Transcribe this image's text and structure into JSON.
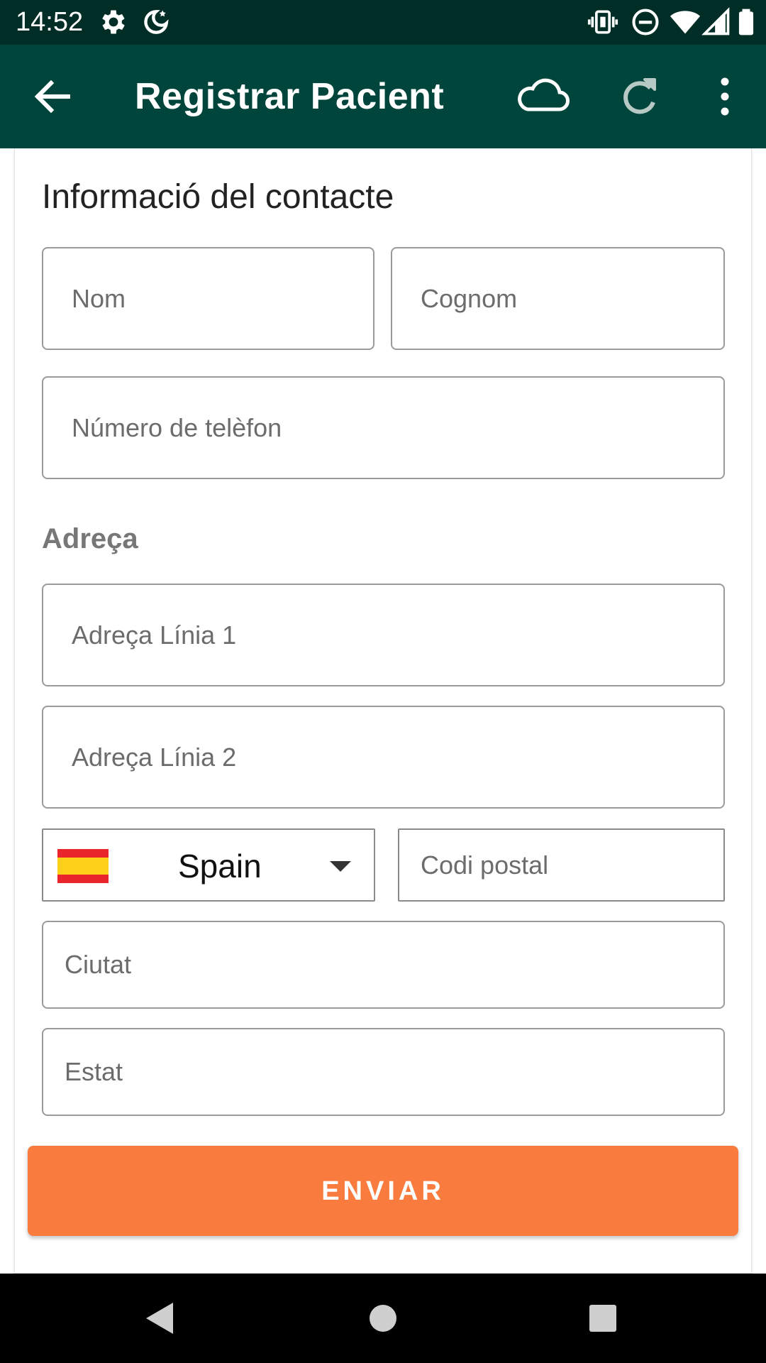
{
  "status_bar": {
    "time": "14:52",
    "left_icons": [
      "settings-icon",
      "night-mode-icon"
    ],
    "right_icons": [
      "vibrate-icon",
      "do-not-disturb-icon",
      "wifi-icon",
      "signal-icon",
      "battery-icon"
    ]
  },
  "app_bar": {
    "title": "Registrar Pacient",
    "back_icon": "arrow-left-icon",
    "actions": [
      "cloud-icon",
      "refresh-icon",
      "more-vert-icon"
    ]
  },
  "form": {
    "section_title": "Informació del contacte",
    "first_name_placeholder": "Nom",
    "last_name_placeholder": "Cognom",
    "phone_placeholder": "Número de telèfon",
    "address_title": "Adreça",
    "address1_placeholder": "Adreça Línia 1",
    "address2_placeholder": "Adreça Línia 2",
    "country": {
      "selected": "Spain",
      "flag": "spain-flag-icon"
    },
    "postal_placeholder": "Codi postal",
    "city_placeholder": "Ciutat",
    "state_placeholder": "Estat",
    "submit_label": "ENVIAR"
  },
  "colors": {
    "status_bar": "#002d26",
    "app_bar": "#00453b",
    "submit_button": "#f97b3e",
    "section_subtitle": "#777777"
  },
  "nav_bar": {
    "buttons": [
      "back-triangle-icon",
      "home-circle-icon",
      "recents-square-icon"
    ]
  }
}
